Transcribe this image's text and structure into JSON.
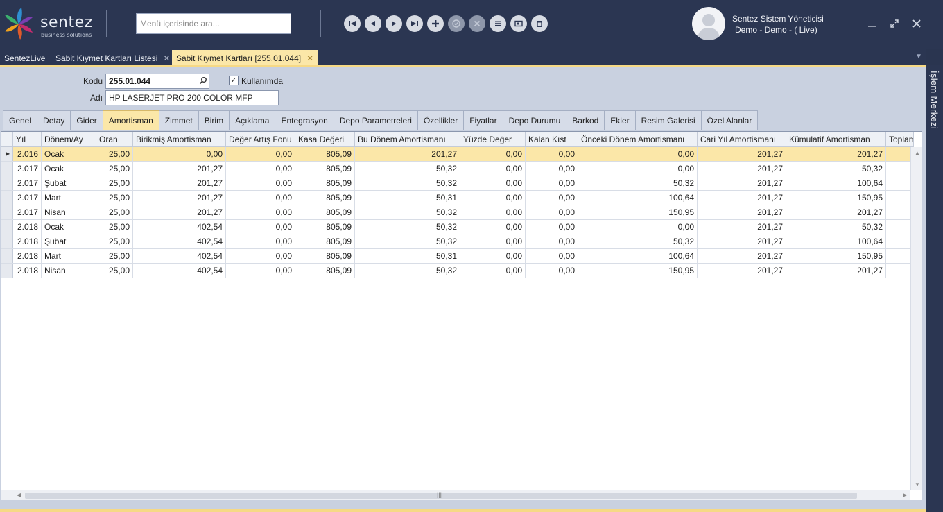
{
  "brand": {
    "name": "sentez",
    "tagline": "business solutions"
  },
  "search": {
    "placeholder": "Menü içerisinde ara..."
  },
  "toolbar": {
    "buttons": [
      {
        "name": "first-record-button",
        "icon": "skip-first-icon",
        "enabled": true
      },
      {
        "name": "previous-record-button",
        "icon": "triangle-left-icon",
        "enabled": true
      },
      {
        "name": "next-record-button",
        "icon": "triangle-right-icon",
        "enabled": true
      },
      {
        "name": "last-record-button",
        "icon": "skip-last-icon",
        "enabled": true
      },
      {
        "name": "add-button",
        "icon": "plus-icon",
        "enabled": true
      },
      {
        "name": "save-button",
        "icon": "check-icon",
        "enabled": false
      },
      {
        "name": "cancel-button",
        "icon": "x-icon",
        "enabled": false
      },
      {
        "name": "list-button",
        "icon": "list-icon",
        "enabled": true
      },
      {
        "name": "card-button",
        "icon": "card-icon",
        "enabled": true
      },
      {
        "name": "delete-button",
        "icon": "trash-icon",
        "enabled": true
      }
    ]
  },
  "user": {
    "name": "Sentez Sistem Yöneticisi",
    "subtitle": "Demo - Demo - ( Live)"
  },
  "doc_tabs": [
    {
      "label": "SentezLive",
      "closable": false,
      "active": false
    },
    {
      "label": "Sabit Kıymet Kartları Listesi",
      "closable": true,
      "active": false
    },
    {
      "label": "Sabit Kıymet Kartları [255.01.044]",
      "closable": true,
      "active": true
    }
  ],
  "side_panel": {
    "label": "İşlem Merkezi"
  },
  "form": {
    "kodu_label": "Kodu",
    "kodu_value": "255.01.044",
    "kullanimda_label": "Kullanımda",
    "kullanimda_checked": true,
    "adi_label": "Adı",
    "adi_value": "HP LASERJET PRO 200 COLOR MFP"
  },
  "page_tabs": [
    {
      "label": "Genel",
      "active": false
    },
    {
      "label": "Detay",
      "active": false
    },
    {
      "label": "Gider",
      "active": false
    },
    {
      "label": "Amortisman",
      "active": true
    },
    {
      "label": "Zimmet",
      "active": false
    },
    {
      "label": "Birim",
      "active": false
    },
    {
      "label": "Açıklama",
      "active": false
    },
    {
      "label": "Entegrasyon",
      "active": false
    },
    {
      "label": "Depo Parametreleri",
      "active": false
    },
    {
      "label": "Özellikler",
      "active": false
    },
    {
      "label": "Fiyatlar",
      "active": false
    },
    {
      "label": "Depo Durumu",
      "active": false
    },
    {
      "label": "Barkod",
      "active": false
    },
    {
      "label": "Ekler",
      "active": false
    },
    {
      "label": "Resim Galerisi",
      "active": false
    },
    {
      "label": "Özel Alanlar",
      "active": false
    }
  ],
  "grid": {
    "columns": [
      "Yıl",
      "Dönem/Ay",
      "Oran",
      "Birikmiş Amortisman",
      "Değer Artış Fonu",
      "Kasa Değeri",
      "Bu Dönem Amortismanı",
      "Yüzde Değer",
      "Kalan Kıst",
      "Önceki Dönem Amortismanı",
      "Cari Yıl Amortismanı",
      "Kümulatif Amortisman",
      "Toplam"
    ],
    "rows": [
      [
        "2.016",
        "Ocak",
        "25,00",
        "0,00",
        "0,00",
        "805,09",
        "201,27",
        "0,00",
        "0,00",
        "0,00",
        "201,27",
        "201,27",
        ""
      ],
      [
        "2.017",
        "Ocak",
        "25,00",
        "201,27",
        "0,00",
        "805,09",
        "50,32",
        "0,00",
        "0,00",
        "0,00",
        "201,27",
        "50,32",
        ""
      ],
      [
        "2.017",
        "Şubat",
        "25,00",
        "201,27",
        "0,00",
        "805,09",
        "50,32",
        "0,00",
        "0,00",
        "50,32",
        "201,27",
        "100,64",
        ""
      ],
      [
        "2.017",
        "Mart",
        "25,00",
        "201,27",
        "0,00",
        "805,09",
        "50,31",
        "0,00",
        "0,00",
        "100,64",
        "201,27",
        "150,95",
        ""
      ],
      [
        "2.017",
        "Nisan",
        "25,00",
        "201,27",
        "0,00",
        "805,09",
        "50,32",
        "0,00",
        "0,00",
        "150,95",
        "201,27",
        "201,27",
        ""
      ],
      [
        "2.018",
        "Ocak",
        "25,00",
        "402,54",
        "0,00",
        "805,09",
        "50,32",
        "0,00",
        "0,00",
        "0,00",
        "201,27",
        "50,32",
        ""
      ],
      [
        "2.018",
        "Şubat",
        "25,00",
        "402,54",
        "0,00",
        "805,09",
        "50,32",
        "0,00",
        "0,00",
        "50,32",
        "201,27",
        "100,64",
        ""
      ],
      [
        "2.018",
        "Mart",
        "25,00",
        "402,54",
        "0,00",
        "805,09",
        "50,31",
        "0,00",
        "0,00",
        "100,64",
        "201,27",
        "150,95",
        ""
      ],
      [
        "2.018",
        "Nisan",
        "25,00",
        "402,54",
        "0,00",
        "805,09",
        "50,32",
        "0,00",
        "0,00",
        "150,95",
        "201,27",
        "201,27",
        ""
      ]
    ],
    "selected_row": 0
  },
  "colors": {
    "header_bg": "#2b3652",
    "accent": "#fbe7a8",
    "content_bg": "#c9d1e0"
  }
}
